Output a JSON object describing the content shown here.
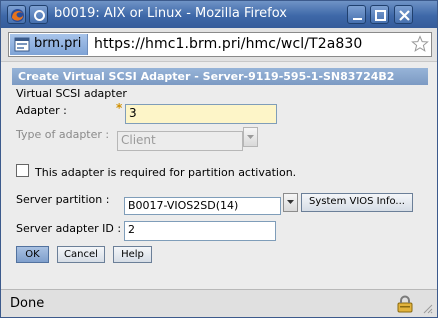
{
  "window": {
    "title": "b0019: AIX or Linux - Mozilla Firefox"
  },
  "urlbar": {
    "site": "brm.pri",
    "url": "https://hmc1.brm.pri/hmc/wcl/T2a830"
  },
  "panel": {
    "header": "Create Virtual SCSI Adapter - Server-9119-595-1-SN83724B2",
    "section_label": "Virtual SCSI adapter"
  },
  "form": {
    "adapter_label": "Adapter :",
    "adapter_required_mark": "*",
    "adapter_value": "3",
    "type_label": "Type of adapter :",
    "type_value": "Client",
    "required_checkbox_label": "This adapter is required for partition activation.",
    "required_checked": false,
    "server_partition_label": "Server partition :",
    "server_partition_value": "B0017-VIOS2SD(14)",
    "system_vios_button": "System VIOS Info...",
    "server_adapter_label": "Server adapter ID :",
    "server_adapter_value": "2"
  },
  "buttons": {
    "ok": "OK",
    "cancel": "Cancel",
    "help": "Help"
  },
  "status": {
    "text": "Done"
  },
  "colors": {
    "titlebar": "#3e68a8",
    "panel_header": "#7c9ac3",
    "required_field": "#fdf5c8"
  }
}
